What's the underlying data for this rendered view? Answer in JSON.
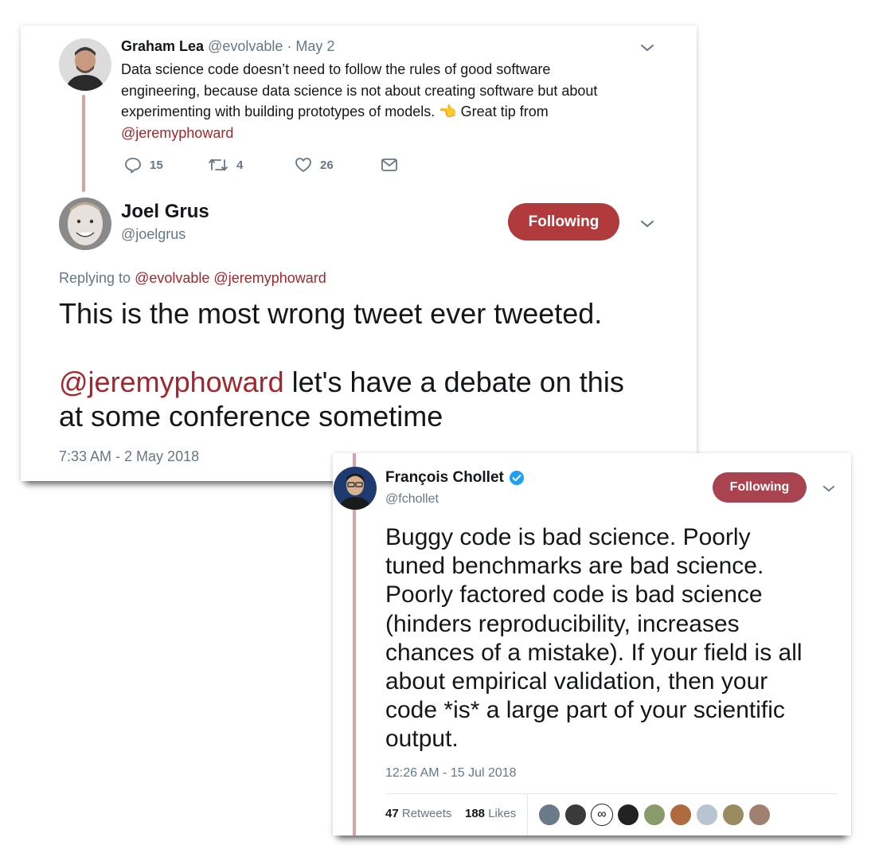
{
  "tweet1": {
    "author_name": "Graham Lea",
    "author_handle": "@evolvable",
    "sep_date": "· May 2",
    "text_lines": [
      "Data science code doesn’t need to follow the rules of good software",
      "engineering, because data science is not about creating software but about",
      "experimenting with building prototypes of models."
    ],
    "text_tail": "Great tip from",
    "emoji": "👈",
    "mention": "@jeremyphoward",
    "replies": "15",
    "retweets": "4",
    "likes": "26"
  },
  "tweet2": {
    "author_name": "Joel Grus",
    "author_handle": "@joelgrus",
    "follow_label": "Following",
    "replying_to_label": "Replying to",
    "replying_to_1": "@evolvable",
    "replying_to_2": "@jeremyphoward",
    "line1": "This is the most wrong tweet ever tweeted.",
    "mention": "@jeremyphoward",
    "line2_rest": " let's have a debate on this",
    "line3": "at some conference sometime",
    "timestamp": "7:33 AM - 2 May 2018"
  },
  "tweet3": {
    "author_name": "François Chollet",
    "author_handle": "@fchollet",
    "follow_label": "Following",
    "text_lines": [
      "Buggy code is bad science. Poorly",
      "tuned benchmarks are bad science.",
      "Poorly factored code is bad science",
      "(hinders reproducibility, increases",
      "chances of a mistake). If your field is all",
      "about empirical validation, then your",
      "code *is* a large part of your scientific",
      "output."
    ],
    "timestamp": "12:26 AM - 15 Jul 2018",
    "retweet_count": "47",
    "retweet_label": "Retweets",
    "like_count": "188",
    "like_label": "Likes"
  },
  "colors": {
    "accent": "#a4262c",
    "follow_btn_1": "#b03a3c",
    "follow_btn_2": "#a8434f",
    "thread_line": "#d4a3a6",
    "muted": "#657786"
  },
  "icons": [
    "reply-icon",
    "retweet-icon",
    "like-icon",
    "message-icon",
    "chevron-down-icon",
    "verified-icon"
  ]
}
